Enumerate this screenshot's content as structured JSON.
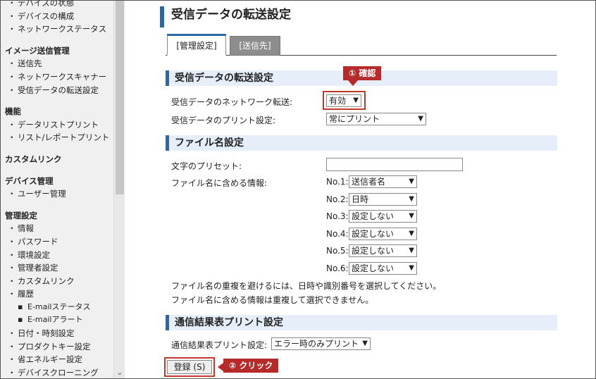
{
  "sidebar": {
    "items": [
      {
        "type": "item",
        "label": "デバイスの状態"
      },
      {
        "type": "item",
        "label": "デバイスの構成"
      },
      {
        "type": "item",
        "label": "ネットワークステータス"
      },
      {
        "type": "head",
        "label": "イメージ送信管理"
      },
      {
        "type": "item",
        "label": "送信先"
      },
      {
        "type": "item",
        "label": "ネットワークスキャナー"
      },
      {
        "type": "item",
        "label": "受信データの転送設定"
      },
      {
        "type": "head",
        "label": "機能"
      },
      {
        "type": "item",
        "label": "データリストプリント"
      },
      {
        "type": "item",
        "label": "リスト/レポートプリント"
      },
      {
        "type": "head",
        "label": "カスタムリンク"
      },
      {
        "type": "head",
        "label": "デバイス管理"
      },
      {
        "type": "item",
        "label": "ユーザー管理"
      },
      {
        "type": "head",
        "label": "管理設定"
      },
      {
        "type": "item",
        "label": "情報"
      },
      {
        "type": "item",
        "label": "パスワード"
      },
      {
        "type": "item",
        "label": "環境設定"
      },
      {
        "type": "item",
        "label": "管理者設定"
      },
      {
        "type": "item",
        "label": "カスタムリンク"
      },
      {
        "type": "item",
        "label": "履歴"
      },
      {
        "type": "sub",
        "label": "E-mailステータス"
      },
      {
        "type": "sub",
        "label": "E-mailアラート"
      },
      {
        "type": "item",
        "label": "日付・時刻設定"
      },
      {
        "type": "item",
        "label": "プロダクトキー設定"
      },
      {
        "type": "item",
        "label": "省エネルギー設定"
      },
      {
        "type": "item",
        "label": "デバイスクローニング"
      }
    ]
  },
  "main": {
    "title": "受信データの転送設定",
    "tabs": {
      "management": "[管理設定]",
      "destination": "[送信先]"
    },
    "section1": {
      "title": "受信データの転送設定",
      "network_transfer_label": "受信データのネットワーク転送:",
      "network_transfer_value": "有効",
      "print_setting_label": "受信データのプリント設定:",
      "print_setting_value": "常にプリント"
    },
    "section2": {
      "title": "ファイル名設定",
      "preset_label": "文字のプリセット:",
      "preset_value": "",
      "info_label": "ファイル名に含める情報:",
      "fields": [
        {
          "no": "No.1:",
          "value": "送信者名"
        },
        {
          "no": "No.2:",
          "value": "日時"
        },
        {
          "no": "No.3:",
          "value": "設定しない"
        },
        {
          "no": "No.4:",
          "value": "設定しない"
        },
        {
          "no": "No.5:",
          "value": "設定しない"
        },
        {
          "no": "No.6:",
          "value": "設定しない"
        }
      ],
      "note1": "ファイル名の重複を避けるには、日時や識別番号を選択してください。",
      "note2": "ファイル名に含める情報は重複して選択できません。"
    },
    "section3": {
      "title": "通信結果表プリント設定",
      "label": "通信結果表プリント設定:",
      "value": "エラー時のみプリント"
    },
    "submit_label": "登録 (S)",
    "callout1": "① 確認",
    "callout2": "② クリック"
  },
  "colors": {
    "accent": "#2c67a6",
    "callout": "#b52a2a",
    "section_bg": "#e5eef9"
  }
}
